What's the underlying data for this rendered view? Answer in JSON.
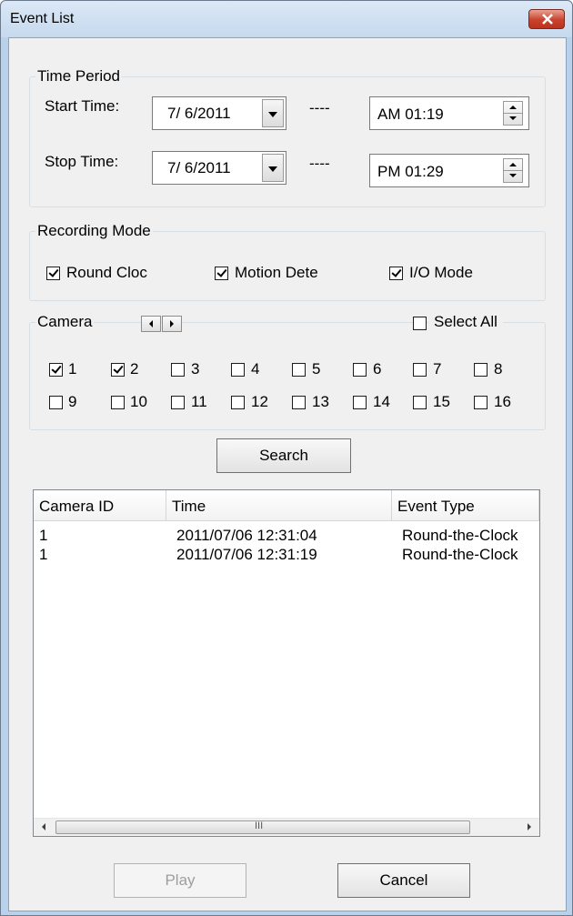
{
  "window": {
    "title": "Event List"
  },
  "time_period": {
    "legend": "Time Period",
    "start": {
      "label": "Start Time:",
      "date": "7/  6/2011",
      "dash": "----",
      "time": "AM  01:19"
    },
    "stop": {
      "label": "Stop Time:",
      "date": "7/  6/2011",
      "dash": "----",
      "time": "PM  01:29"
    }
  },
  "recording_mode": {
    "legend": "Recording Mode",
    "options": [
      {
        "label": "Round Cloc",
        "checked": true
      },
      {
        "label": "Motion Dete",
        "checked": true
      },
      {
        "label": "I/O Mode",
        "checked": true
      }
    ]
  },
  "camera": {
    "legend": "Camera",
    "select_all_label": "Select All",
    "select_all_checked": false,
    "cameras": [
      {
        "label": "1",
        "checked": true
      },
      {
        "label": "2",
        "checked": true
      },
      {
        "label": "3",
        "checked": false
      },
      {
        "label": "4",
        "checked": false
      },
      {
        "label": "5",
        "checked": false
      },
      {
        "label": "6",
        "checked": false
      },
      {
        "label": "7",
        "checked": false
      },
      {
        "label": "8",
        "checked": false
      },
      {
        "label": "9",
        "checked": false
      },
      {
        "label": "10",
        "checked": false
      },
      {
        "label": "11",
        "checked": false
      },
      {
        "label": "12",
        "checked": false
      },
      {
        "label": "13",
        "checked": false
      },
      {
        "label": "14",
        "checked": false
      },
      {
        "label": "15",
        "checked": false
      },
      {
        "label": "16",
        "checked": false
      }
    ]
  },
  "search_button": "Search",
  "event_table": {
    "columns": [
      "Camera ID",
      "Time",
      "Event Type"
    ],
    "rows": [
      {
        "camera_id": "1",
        "time": "2011/07/06 12:31:04",
        "event_type": "Round-the-Clock"
      },
      {
        "camera_id": "1",
        "time": "2011/07/06 12:31:19",
        "event_type": "Round-the-Clock"
      }
    ],
    "scroll_grip": "III"
  },
  "buttons": {
    "play": "Play",
    "cancel": "Cancel"
  },
  "colors": {
    "close_button": "#c8422c",
    "default_button_border": "#3c7fb1"
  }
}
